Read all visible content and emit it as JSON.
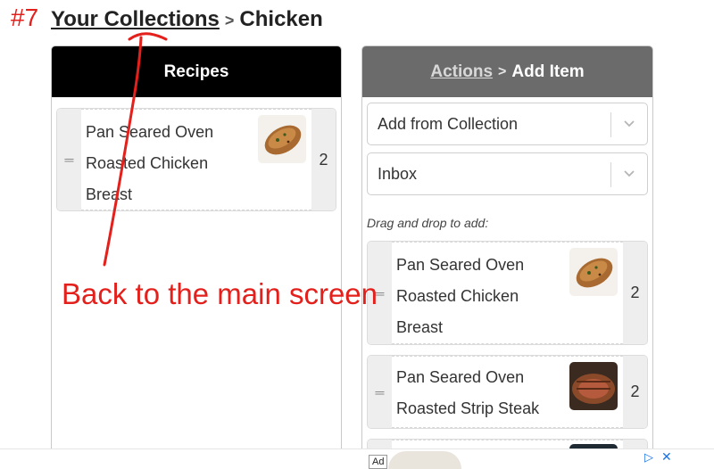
{
  "annotation": {
    "step_number": "#7",
    "callout": "Back to the main screen"
  },
  "breadcrumb": {
    "collections": "Your Collections",
    "separator": ">",
    "current": "Chicken"
  },
  "left_panel": {
    "header": "Recipes",
    "items": [
      {
        "title_line1": "Pan Seared Oven",
        "title_line2": "Roasted Chicken",
        "title_line3": "Breast",
        "count": "2",
        "thumb_icon": "roasted-chicken-photo"
      }
    ]
  },
  "right_panel": {
    "header_link": "Actions",
    "header_separator": ">",
    "header_title": "Add Item",
    "source_select": "Add from Collection",
    "collection_select": "Inbox",
    "hint": "Drag and drop to add:",
    "items": [
      {
        "title_line1": "Pan Seared Oven",
        "title_line2": "Roasted Chicken",
        "title_line3": "Breast",
        "count": "2",
        "thumb_icon": "roasted-chicken-photo"
      },
      {
        "title_line1": "Pan Seared Oven",
        "title_line2": "Roasted Strip Steak",
        "count": "2",
        "thumb_icon": "strip-steak-photo"
      }
    ]
  },
  "ad": {
    "label": "Ad",
    "play_icon": "ad-choices-icon",
    "close_icon": "close-icon"
  },
  "colors": {
    "annotation_red": "#e3201b",
    "left_header": "#000000",
    "right_header": "#6b6b6b",
    "ad_blue": "#1a73e8"
  }
}
